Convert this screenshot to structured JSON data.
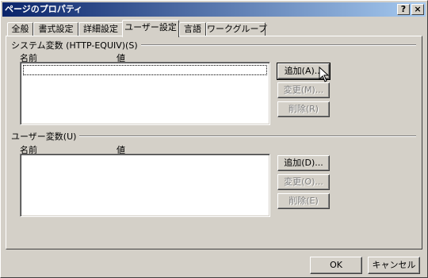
{
  "window": {
    "title": "ページのプロパティ",
    "help_button": "?",
    "close_button": "×"
  },
  "tabs": [
    {
      "label": "全般",
      "active": false
    },
    {
      "label": "書式設定",
      "active": false
    },
    {
      "label": "詳細設定",
      "active": false
    },
    {
      "label": "ユーザー設定",
      "active": true
    },
    {
      "label": "言語",
      "active": false
    },
    {
      "label": "ワークグループ",
      "active": false
    }
  ],
  "system_vars": {
    "group_label": "システム変数 (HTTP-EQUIV)(S)",
    "col_name": "名前",
    "col_value": "値",
    "buttons": {
      "add": "追加(A)...",
      "modify": "変更(M)...",
      "delete": "削除(R)"
    }
  },
  "user_vars": {
    "group_label": "ユーザー変数(U)",
    "col_name": "名前",
    "col_value": "値",
    "buttons": {
      "add": "追加(D)...",
      "modify": "変更(O)...",
      "delete": "削除(E)"
    }
  },
  "footer": {
    "ok": "OK",
    "cancel": "キャンセル"
  },
  "colors": {
    "title_start": "#0a246a",
    "title_end": "#a6caf0",
    "face": "#d4d0c8"
  }
}
